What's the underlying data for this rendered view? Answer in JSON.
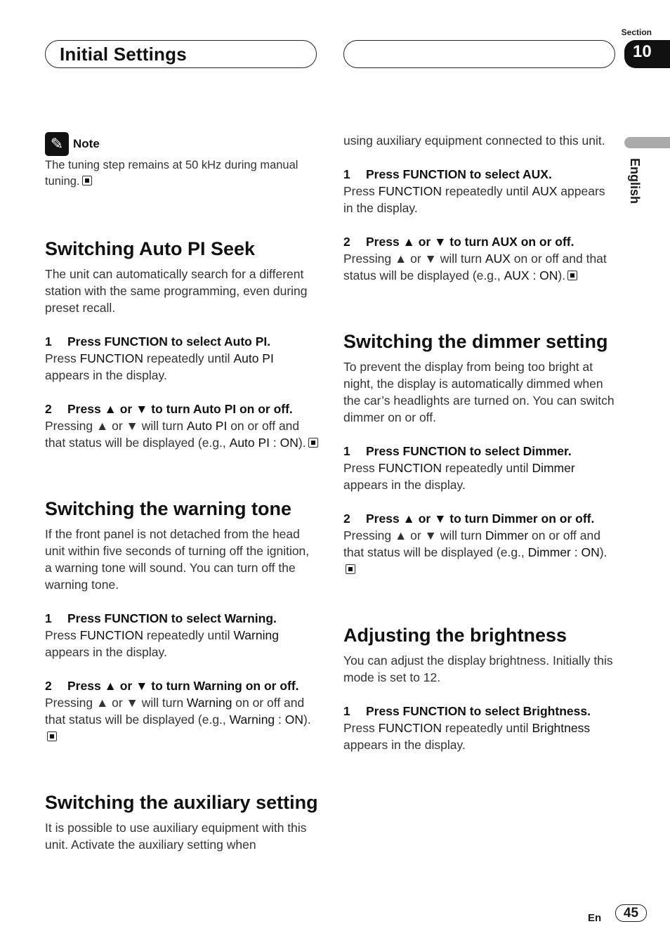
{
  "header": {
    "title": "Initial Settings",
    "section_label": "Section",
    "section_number": "10",
    "language": "English"
  },
  "note": {
    "label": "Note",
    "text": "The tuning step remains at 50 kHz during manual tuning."
  },
  "auto_pi": {
    "title": "Switching Auto PI Seek",
    "intro": "The unit can automatically search for a different station with the same programming, even during preset recall.",
    "step1_num": "1",
    "step1_title": "Press FUNCTION to select Auto PI.",
    "step1_a": "Press ",
    "step1_b": "FUNCTION",
    "step1_c": " repeatedly until ",
    "step1_d": "Auto PI",
    "step1_e": " appears in the display.",
    "step2_num": "2",
    "step2_title": "Press ▲ or ▼ to turn Auto PI on or off.",
    "step2_a": "Pressing ▲ or ▼ will turn ",
    "step2_b": "Auto PI",
    "step2_c": " on or off and that status will be displayed (e.g., ",
    "step2_d": "Auto PI : ON",
    "step2_e": ")."
  },
  "warning": {
    "title": "Switching the warning tone",
    "intro": "If the front panel is not detached from the head unit within five seconds of turning off the ignition, a warning tone will sound. You can turn off the warning tone.",
    "step1_num": "1",
    "step1_title": "Press FUNCTION to select Warning.",
    "step1_a": "Press ",
    "step1_b": "FUNCTION",
    "step1_c": " repeatedly until ",
    "step1_d": "Warning",
    "step1_e": " appears in the display.",
    "step2_num": "2",
    "step2_title": "Press ▲ or ▼ to turn Warning on or off.",
    "step2_a": "Pressing ▲ or ▼ will turn ",
    "step2_b": "Warning",
    "step2_c": " on or off and that status will be displayed (e.g., ",
    "step2_d": "Warning : ON",
    "step2_e": ")."
  },
  "aux": {
    "title": "Switching the auxiliary setting",
    "intro1": "It is possible to use auxiliary equipment with this unit. Activate the auxiliary setting when",
    "intro2": "using auxiliary equipment connected to this unit.",
    "step1_num": "1",
    "step1_title": "Press FUNCTION to select AUX.",
    "step1_a": "Press ",
    "step1_b": "FUNCTION",
    "step1_c": " repeatedly until ",
    "step1_d": "AUX",
    "step1_e": " appears in the display.",
    "step2_num": "2",
    "step2_title": "Press ▲ or ▼ to turn AUX on or off.",
    "step2_a": "Pressing ▲ or ▼ will turn ",
    "step2_b": "AUX",
    "step2_c": " on or off and that status will be displayed (e.g., ",
    "step2_d": "AUX : ON",
    "step2_e": ")."
  },
  "dimmer": {
    "title": "Switching the dimmer setting",
    "intro": "To prevent the display from being too bright at night, the display is automatically dimmed when the car’s headlights are turned on. You can switch dimmer on or off.",
    "step1_num": "1",
    "step1_title": "Press FUNCTION to select Dimmer.",
    "step1_a": "Press ",
    "step1_b": "FUNCTION",
    "step1_c": " repeatedly until ",
    "step1_d": "Dimmer",
    "step1_e": " appears in the display.",
    "step2_num": "2",
    "step2_title": "Press ▲ or ▼ to turn Dimmer on or off.",
    "step2_a": "Pressing ▲ or ▼ will turn ",
    "step2_b": "Dimmer",
    "step2_c": " on or off and that status will be displayed (e.g., ",
    "step2_d": "Dimmer : ON",
    "step2_e": ")."
  },
  "brightness": {
    "title": "Adjusting the brightness",
    "intro": "You can adjust the display brightness. Initially this mode is set to 12.",
    "step1_num": "1",
    "step1_title": "Press FUNCTION to select Brightness.",
    "step1_a": "Press ",
    "step1_b": "FUNCTION",
    "step1_c": " repeatedly until ",
    "step1_d": "Brightness",
    "step1_e": " appears in the display."
  },
  "footer": {
    "lang_code": "En",
    "page_number": "45"
  }
}
